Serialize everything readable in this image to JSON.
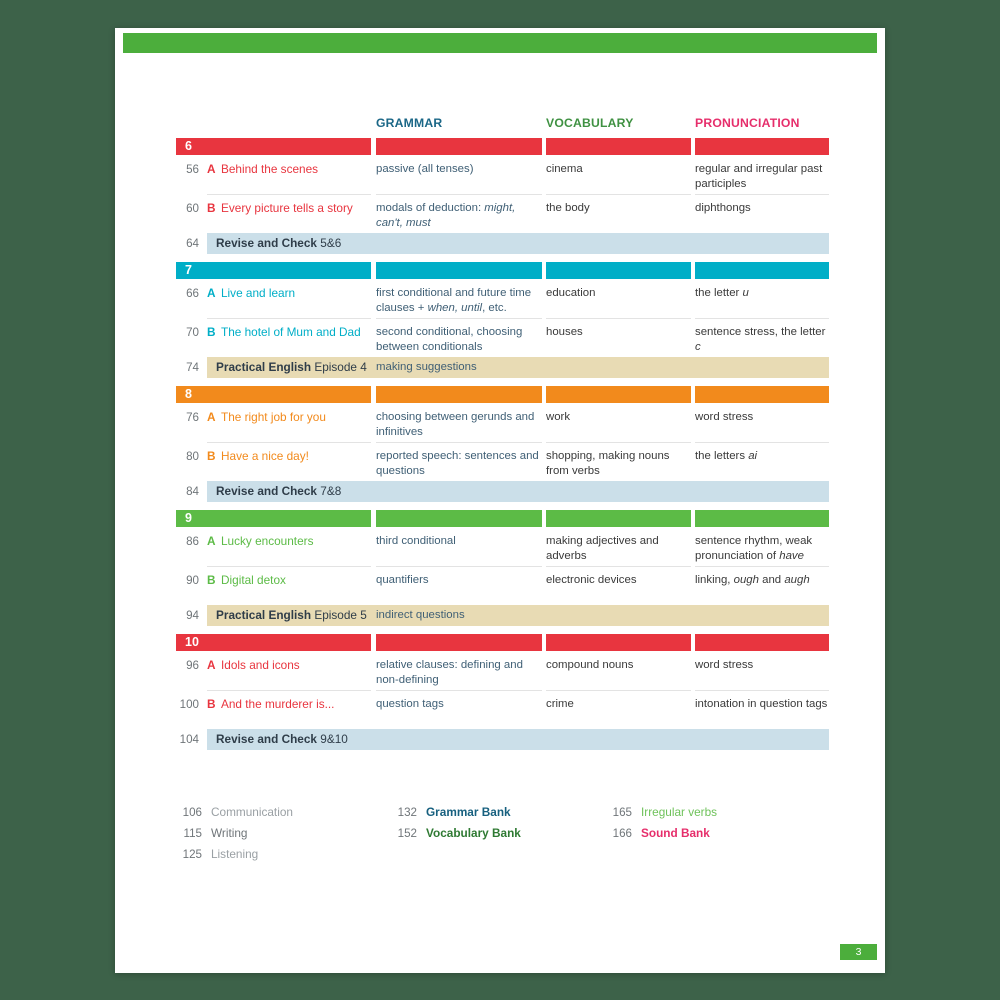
{
  "page": {
    "number_badge": "3",
    "top_bar_color": "#4cae3c",
    "background_color": "#3d6249"
  },
  "columns": {
    "grammar": "GRAMMAR",
    "vocabulary": "VOCABULARY",
    "pronunciation": "PRONUNCIATION",
    "grammar_color": "#1b6787",
    "vocabulary_color": "#3f9142",
    "pronunciation_color": "#e62e6b"
  },
  "units": [
    {
      "number": "6",
      "color": "#e8353f",
      "lessons": [
        {
          "page": "56",
          "letter": "A",
          "title": "Behind the scenes",
          "grammar": "passive (all tenses)",
          "vocabulary": "cinema",
          "pronunciation": "regular and irregular past participles"
        },
        {
          "page": "60",
          "letter": "B",
          "title": "Every picture tells a story",
          "grammar": "modals of deduction: <i>might, can't, must</i>",
          "vocabulary": "the body",
          "pronunciation": "diphthongs"
        }
      ],
      "strip": {
        "type": "revise",
        "page": "64",
        "label_bold": "Revise and Check",
        "label_rest": "5&amp;6",
        "extra": ""
      }
    },
    {
      "number": "7",
      "color": "#00aec7",
      "lessons": [
        {
          "page": "66",
          "letter": "A",
          "title": "Live and learn",
          "grammar": "first conditional and future time clauses + <i>when, until</i>, etc.",
          "vocabulary": "education",
          "pronunciation": "the letter <i>u</i>"
        },
        {
          "page": "70",
          "letter": "B",
          "title": "The hotel of Mum and Dad",
          "grammar": "second conditional, choosing between conditionals",
          "vocabulary": "houses",
          "pronunciation": "sentence stress, the letter <i>c</i>"
        }
      ],
      "strip": {
        "type": "practical",
        "page": "74",
        "label_bold": "Practical English",
        "label_rest": "Episode 4",
        "extra": "making suggestions"
      }
    },
    {
      "number": "8",
      "color": "#f28a1c",
      "lessons": [
        {
          "page": "76",
          "letter": "A",
          "title": "The right job for you",
          "grammar": "choosing between gerunds and infinitives",
          "vocabulary": "work",
          "pronunciation": "word stress"
        },
        {
          "page": "80",
          "letter": "B",
          "title": "Have a nice day!",
          "grammar": "reported speech: sentences and questions",
          "vocabulary": "shopping, making nouns from verbs",
          "pronunciation": "the letters <i>ai</i>"
        }
      ],
      "strip": {
        "type": "revise",
        "page": "84",
        "label_bold": "Revise and Check",
        "label_rest": "7&amp;8",
        "extra": ""
      }
    },
    {
      "number": "9",
      "color": "#5cbb46",
      "lessons": [
        {
          "page": "86",
          "letter": "A",
          "title": "Lucky encounters",
          "grammar": "third conditional",
          "vocabulary": "making adjectives and adverbs",
          "pronunciation": "sentence rhythm, weak pronunciation of <i>have</i>"
        },
        {
          "page": "90",
          "letter": "B",
          "title": "Digital detox",
          "grammar": "quantifiers",
          "vocabulary": "electronic devices",
          "pronunciation": "linking, <i>ough</i> and <i>augh</i>"
        }
      ],
      "strip": {
        "type": "practical",
        "page": "94",
        "label_bold": "Practical English",
        "label_rest": "Episode 5",
        "extra": "indirect questions"
      }
    },
    {
      "number": "10",
      "color": "#e8353f",
      "lessons": [
        {
          "page": "96",
          "letter": "A",
          "title": "Idols and icons",
          "grammar": "relative clauses: defining and non-defining",
          "vocabulary": "compound nouns",
          "pronunciation": "word stress"
        },
        {
          "page": "100",
          "letter": "B",
          "title": "And the murderer is...",
          "grammar": "question tags",
          "vocabulary": "crime",
          "pronunciation": "intonation in question tags"
        }
      ],
      "strip": {
        "type": "revise",
        "page": "104",
        "label_bold": "Revise and Check",
        "label_rest": "9&amp;10",
        "extra": ""
      }
    }
  ],
  "back_matter": [
    [
      {
        "page": "106",
        "label": "Communication",
        "color": "#9aa0a4",
        "bold": false
      },
      {
        "page": "115",
        "label": "Writing",
        "color": "#6f7579",
        "bold": false
      },
      {
        "page": "125",
        "label": "Listening",
        "color": "#9aa0a4",
        "bold": false
      }
    ],
    [
      {
        "page": "132",
        "label": "Grammar Bank",
        "color": "#17607f",
        "bold": true
      },
      {
        "page": "152",
        "label": "Vocabulary Bank",
        "color": "#2f7a33",
        "bold": true
      }
    ],
    [
      {
        "page": "165",
        "label": "Irregular verbs",
        "color": "#6ec25a",
        "bold": false
      },
      {
        "page": "166",
        "label": "Sound Bank",
        "color": "#e62e6b",
        "bold": true
      }
    ]
  ]
}
